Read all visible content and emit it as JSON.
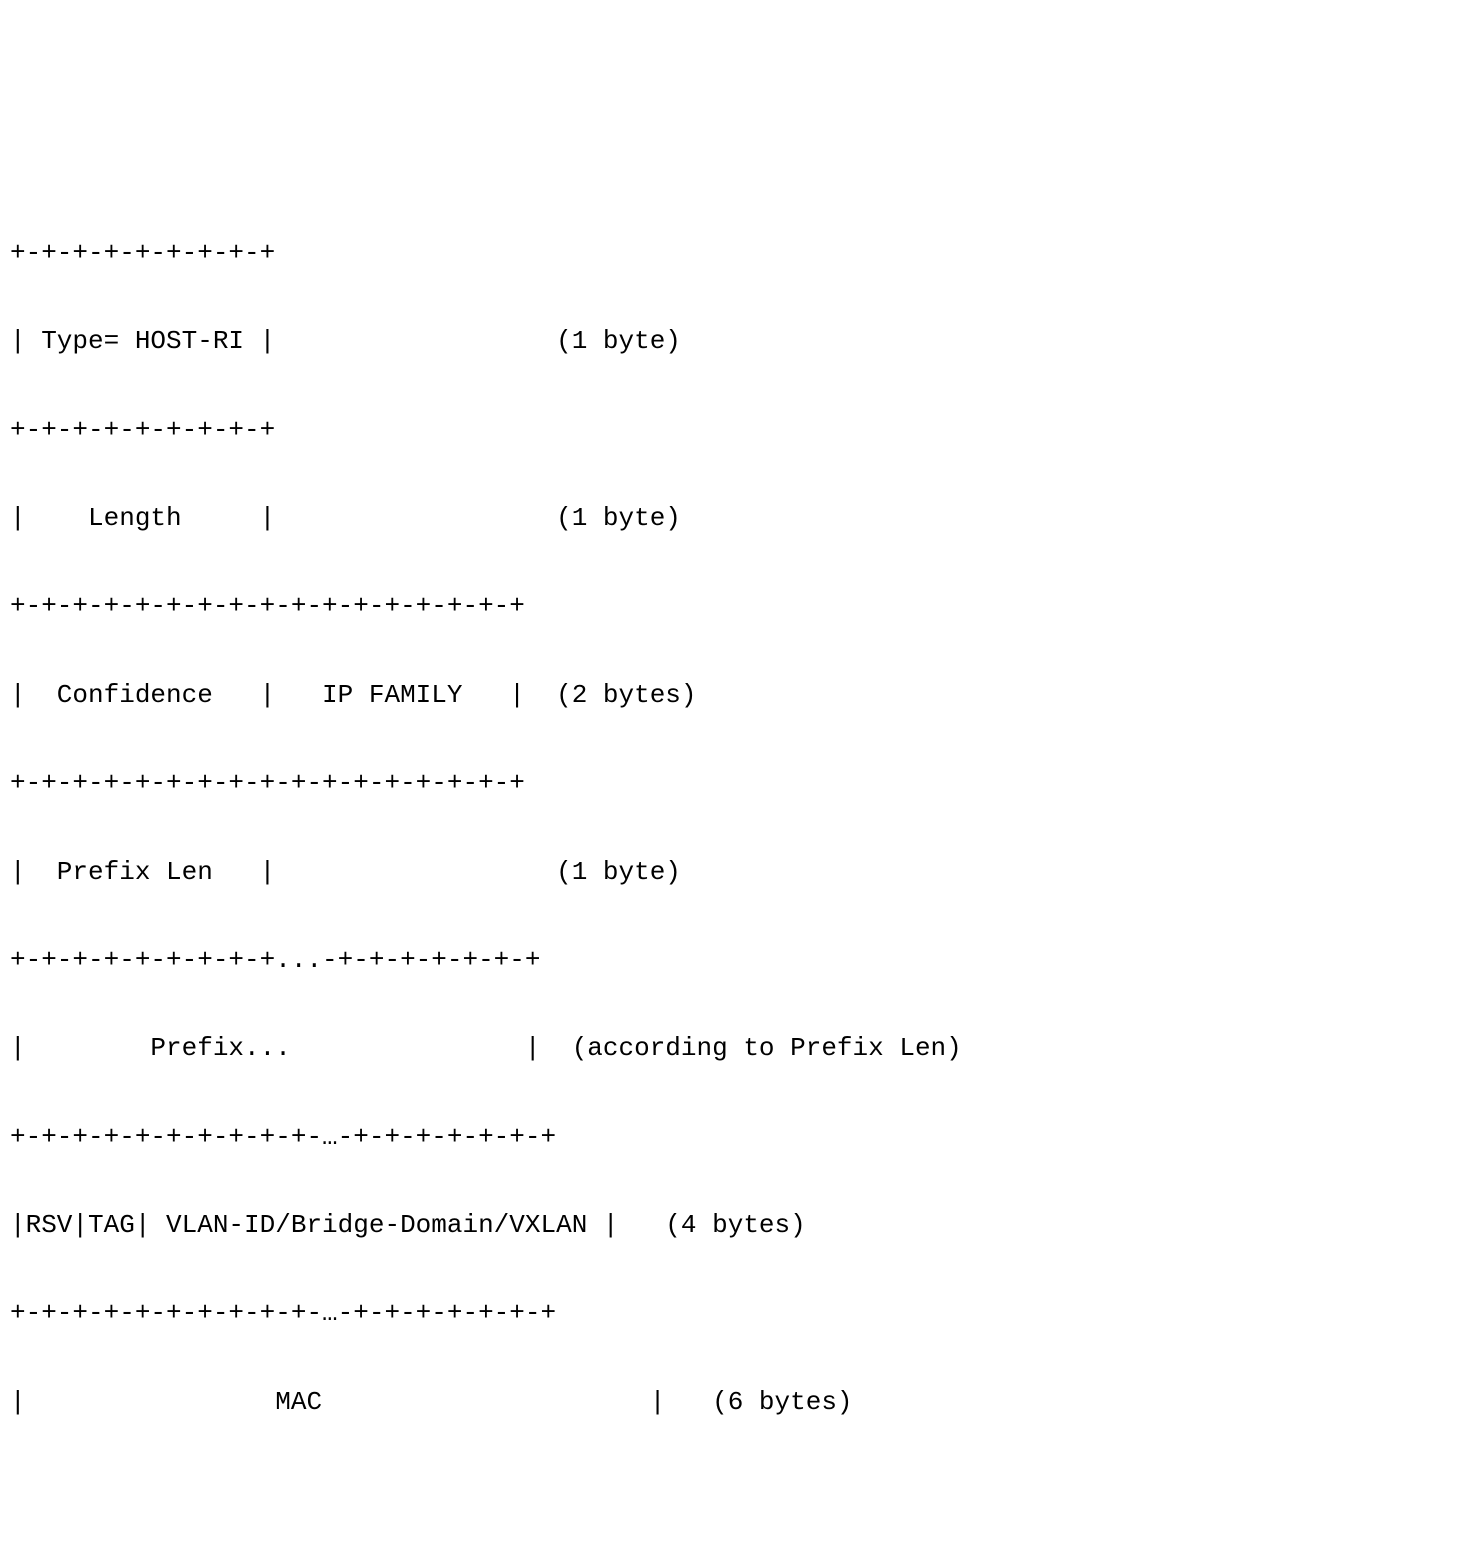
{
  "lines": [
    "+-+-+-+-+-+-+-+-+",
    "| Type= HOST-RI |                  (1 byte)",
    "+-+-+-+-+-+-+-+-+",
    "|    Length     |                  (1 byte)",
    "+-+-+-+-+-+-+-+-+-+-+-+-+-+-+-+-+",
    "|  Confidence   |   IP FAMILY   |  (2 bytes)",
    "+-+-+-+-+-+-+-+-+-+-+-+-+-+-+-+-+",
    "|  Prefix Len   |                  (1 byte)",
    "+-+-+-+-+-+-+-+-+...-+-+-+-+-+-+-+",
    "|        Prefix...               |  (according to Prefix Len)",
    "+-+-+-+-+-+-+-+-+-+-…-+-+-+-+-+-+-+",
    "|RSV|TAG| VLAN-ID/Bridge-Domain/VXLAN |   (4 bytes)",
    "+-+-+-+-+-+-+-+-+-+-…-+-+-+-+-+-+-+",
    "|                MAC                     |   (6 bytes)"
  ],
  "structure": {
    "fields": [
      {
        "name": "Type",
        "value": "HOST-RI",
        "size": "1 byte"
      },
      {
        "name": "Length",
        "size": "1 byte"
      },
      {
        "name": "Confidence",
        "size_group": "2 bytes"
      },
      {
        "name": "IP FAMILY",
        "size_group": "2 bytes"
      },
      {
        "name": "Prefix Len",
        "size": "1 byte"
      },
      {
        "name": "Prefix...",
        "size": "according to Prefix Len"
      },
      {
        "name": "RSV"
      },
      {
        "name": "TAG"
      },
      {
        "name": "VLAN-ID/Bridge-Domain/VXLAN",
        "size": "4 bytes"
      },
      {
        "name": "MAC",
        "size": "6 bytes"
      }
    ]
  }
}
